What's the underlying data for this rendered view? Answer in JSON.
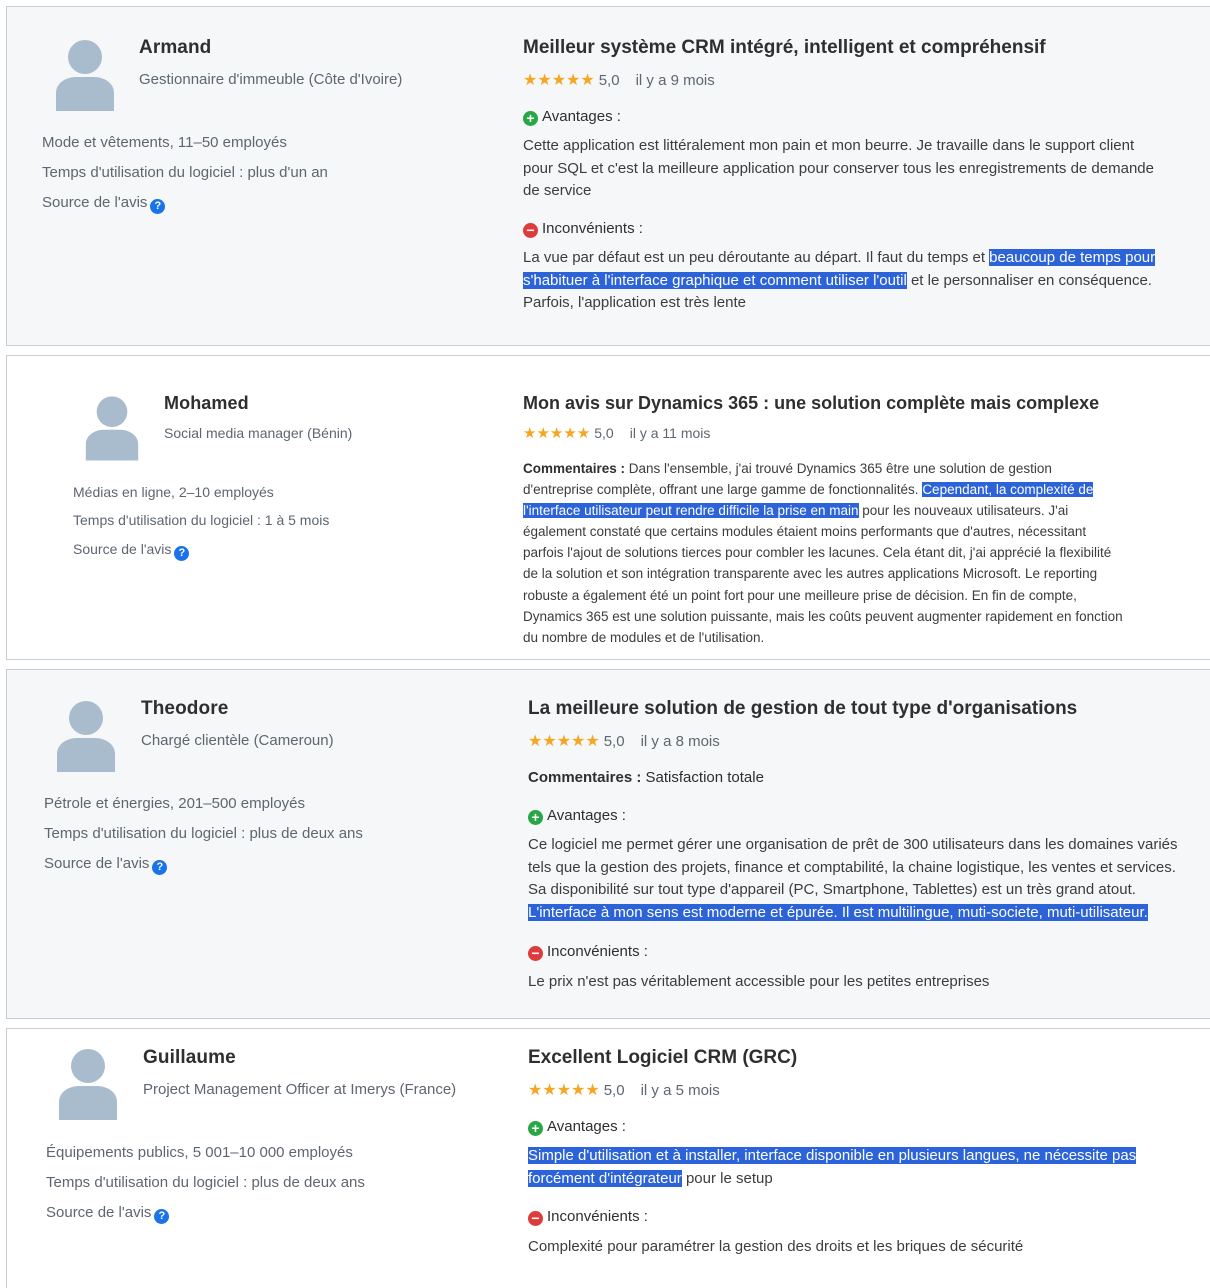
{
  "reviews": [
    {
      "name": "Armand",
      "role": "Gestionnaire d'immeuble (Côte d'Ivoire)",
      "industry": "Mode et vêtements, 11–50 employés",
      "usage": "Temps d'utilisation du logiciel : plus d'un an",
      "source": "Source de l'avis",
      "title": "Meilleur système CRM intégré, intelligent et compréhensif",
      "stars": "★★★★★",
      "score": "5,0",
      "date": "il y a 9 mois",
      "pros_label": "Avantages :",
      "pros": "Cette application est littéralement mon pain et mon beurre. Je travaille dans le support client pour SQL et c'est la meilleure application pour conserver tous les enregistrements de demande de service",
      "cons_label": "Inconvénients :",
      "cons_pre": "La vue par défaut est un peu déroutante au départ. Il faut du temps et ",
      "cons_hl": "beaucoup de temps pour s'habituer à l'interface graphique et comment utiliser l'outil",
      "cons_post": " et le personnaliser en conséquence. Parfois, l'application est très lente"
    },
    {
      "name": "Mohamed",
      "role": "Social media manager (Bénin)",
      "industry": "Médias en ligne, 2–10 employés",
      "usage": "Temps d'utilisation du logiciel : 1 à 5 mois",
      "source": "Source de l'avis",
      "title": "Mon avis sur Dynamics 365 : une solution complète mais complexe",
      "stars": "★★★★★",
      "score": "5,0",
      "date": "il y a 11 mois",
      "comments_label": "Commentaires :",
      "comments_pre": " Dans l'ensemble, j'ai trouvé Dynamics 365 être une solution de gestion d'entreprise complète, offrant une large gamme de fonctionnalités. ",
      "comments_hl": "Cependant, la complexité de l'interface utilisateur peut rendre difficile la prise en main",
      "comments_post": " pour les nouveaux utilisateurs. J'ai également constaté que certains modules étaient moins performants que d'autres, nécessitant parfois l'ajout de solutions tierces pour combler les lacunes. Cela étant dit, j'ai apprécié la flexibilité de la solution et son intégration transparente avec les autres applications Microsoft. Le reporting robuste a également été un point fort pour une meilleure prise de décision. En fin de compte, Dynamics 365 est une solution puissante, mais les coûts peuvent augmenter rapidement en fonction du nombre de modules et de l'utilisation."
    },
    {
      "name": "Theodore",
      "role": "Chargé clientèle (Cameroun)",
      "industry": "Pétrole et énergies, 201–500 employés",
      "usage": "Temps d'utilisation du logiciel : plus de deux ans",
      "source": "Source de l'avis",
      "title": "La meilleure solution de gestion de tout type d'organisations",
      "stars": "★★★★★",
      "score": "5,0",
      "date": "il y a 8 mois",
      "comments_label": "Commentaires :",
      "comments": " Satisfaction totale",
      "pros_label": "Avantages :",
      "pros_pre": "Ce logiciel me permet gérer une organisation de prêt de 300 utilisateurs dans les domaines variés tels que la gestion des projets, finance et comptabilité, la chaine logistique, les ventes et services. Sa disponibilité sur tout type d'appareil (PC, Smartphone, Tablettes) est un très grand atout. ",
      "pros_hl": "L'interface à mon sens est moderne et épurée. Il est multilingue, muti-societe, muti-utilisateur.",
      "cons_label": "Inconvénients :",
      "cons": "Le prix n'est pas véritablement accessible pour les petites entreprises"
    },
    {
      "name": "Guillaume",
      "role": "Project Management Officer at Imerys (France)",
      "industry": "Équipements publics, 5 001–10 000 employés",
      "usage": "Temps d'utilisation du logiciel : plus de deux ans",
      "source": "Source de l'avis",
      "title": "Excellent Logiciel CRM (GRC)",
      "stars": "★★★★★",
      "score": "5,0",
      "date": "il y a 5 mois",
      "pros_label": "Avantages :",
      "pros_hl": "Simple d'utilisation et à installer, interface disponible en plusieurs langues, ne nécessite pas forcément d'intégrateur",
      "pros_post": " pour le setup",
      "cons_label": "Inconvénients :",
      "cons": "Complexité pour paramétrer la gestion des droits et les briques de sécurité"
    }
  ],
  "colors": {
    "highlight": "#2c63d8",
    "star": "#f5a623",
    "pros_icon": "#2aa745",
    "cons_icon": "#dd3c3c",
    "help_icon": "#1a73e8"
  },
  "icons": {
    "avatar": "user-avatar-icon",
    "help": "question-circle-icon",
    "pros": "plus-circle-icon",
    "cons": "minus-circle-icon",
    "star": "star-icon"
  }
}
